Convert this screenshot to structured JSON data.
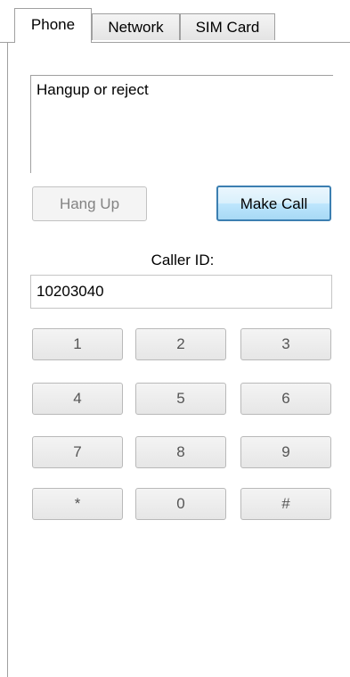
{
  "tabs": [
    {
      "label": "Phone",
      "active": true
    },
    {
      "label": "Network",
      "active": false
    },
    {
      "label": "SIM Card",
      "active": false
    }
  ],
  "status": {
    "text": "Hangup or reject"
  },
  "buttons": {
    "hang_up": "Hang Up",
    "make_call": "Make Call"
  },
  "caller_id": {
    "label": "Caller ID:",
    "value": "10203040"
  },
  "keypad": [
    "1",
    "2",
    "3",
    "4",
    "5",
    "6",
    "7",
    "8",
    "9",
    "*",
    "0",
    "#"
  ]
}
